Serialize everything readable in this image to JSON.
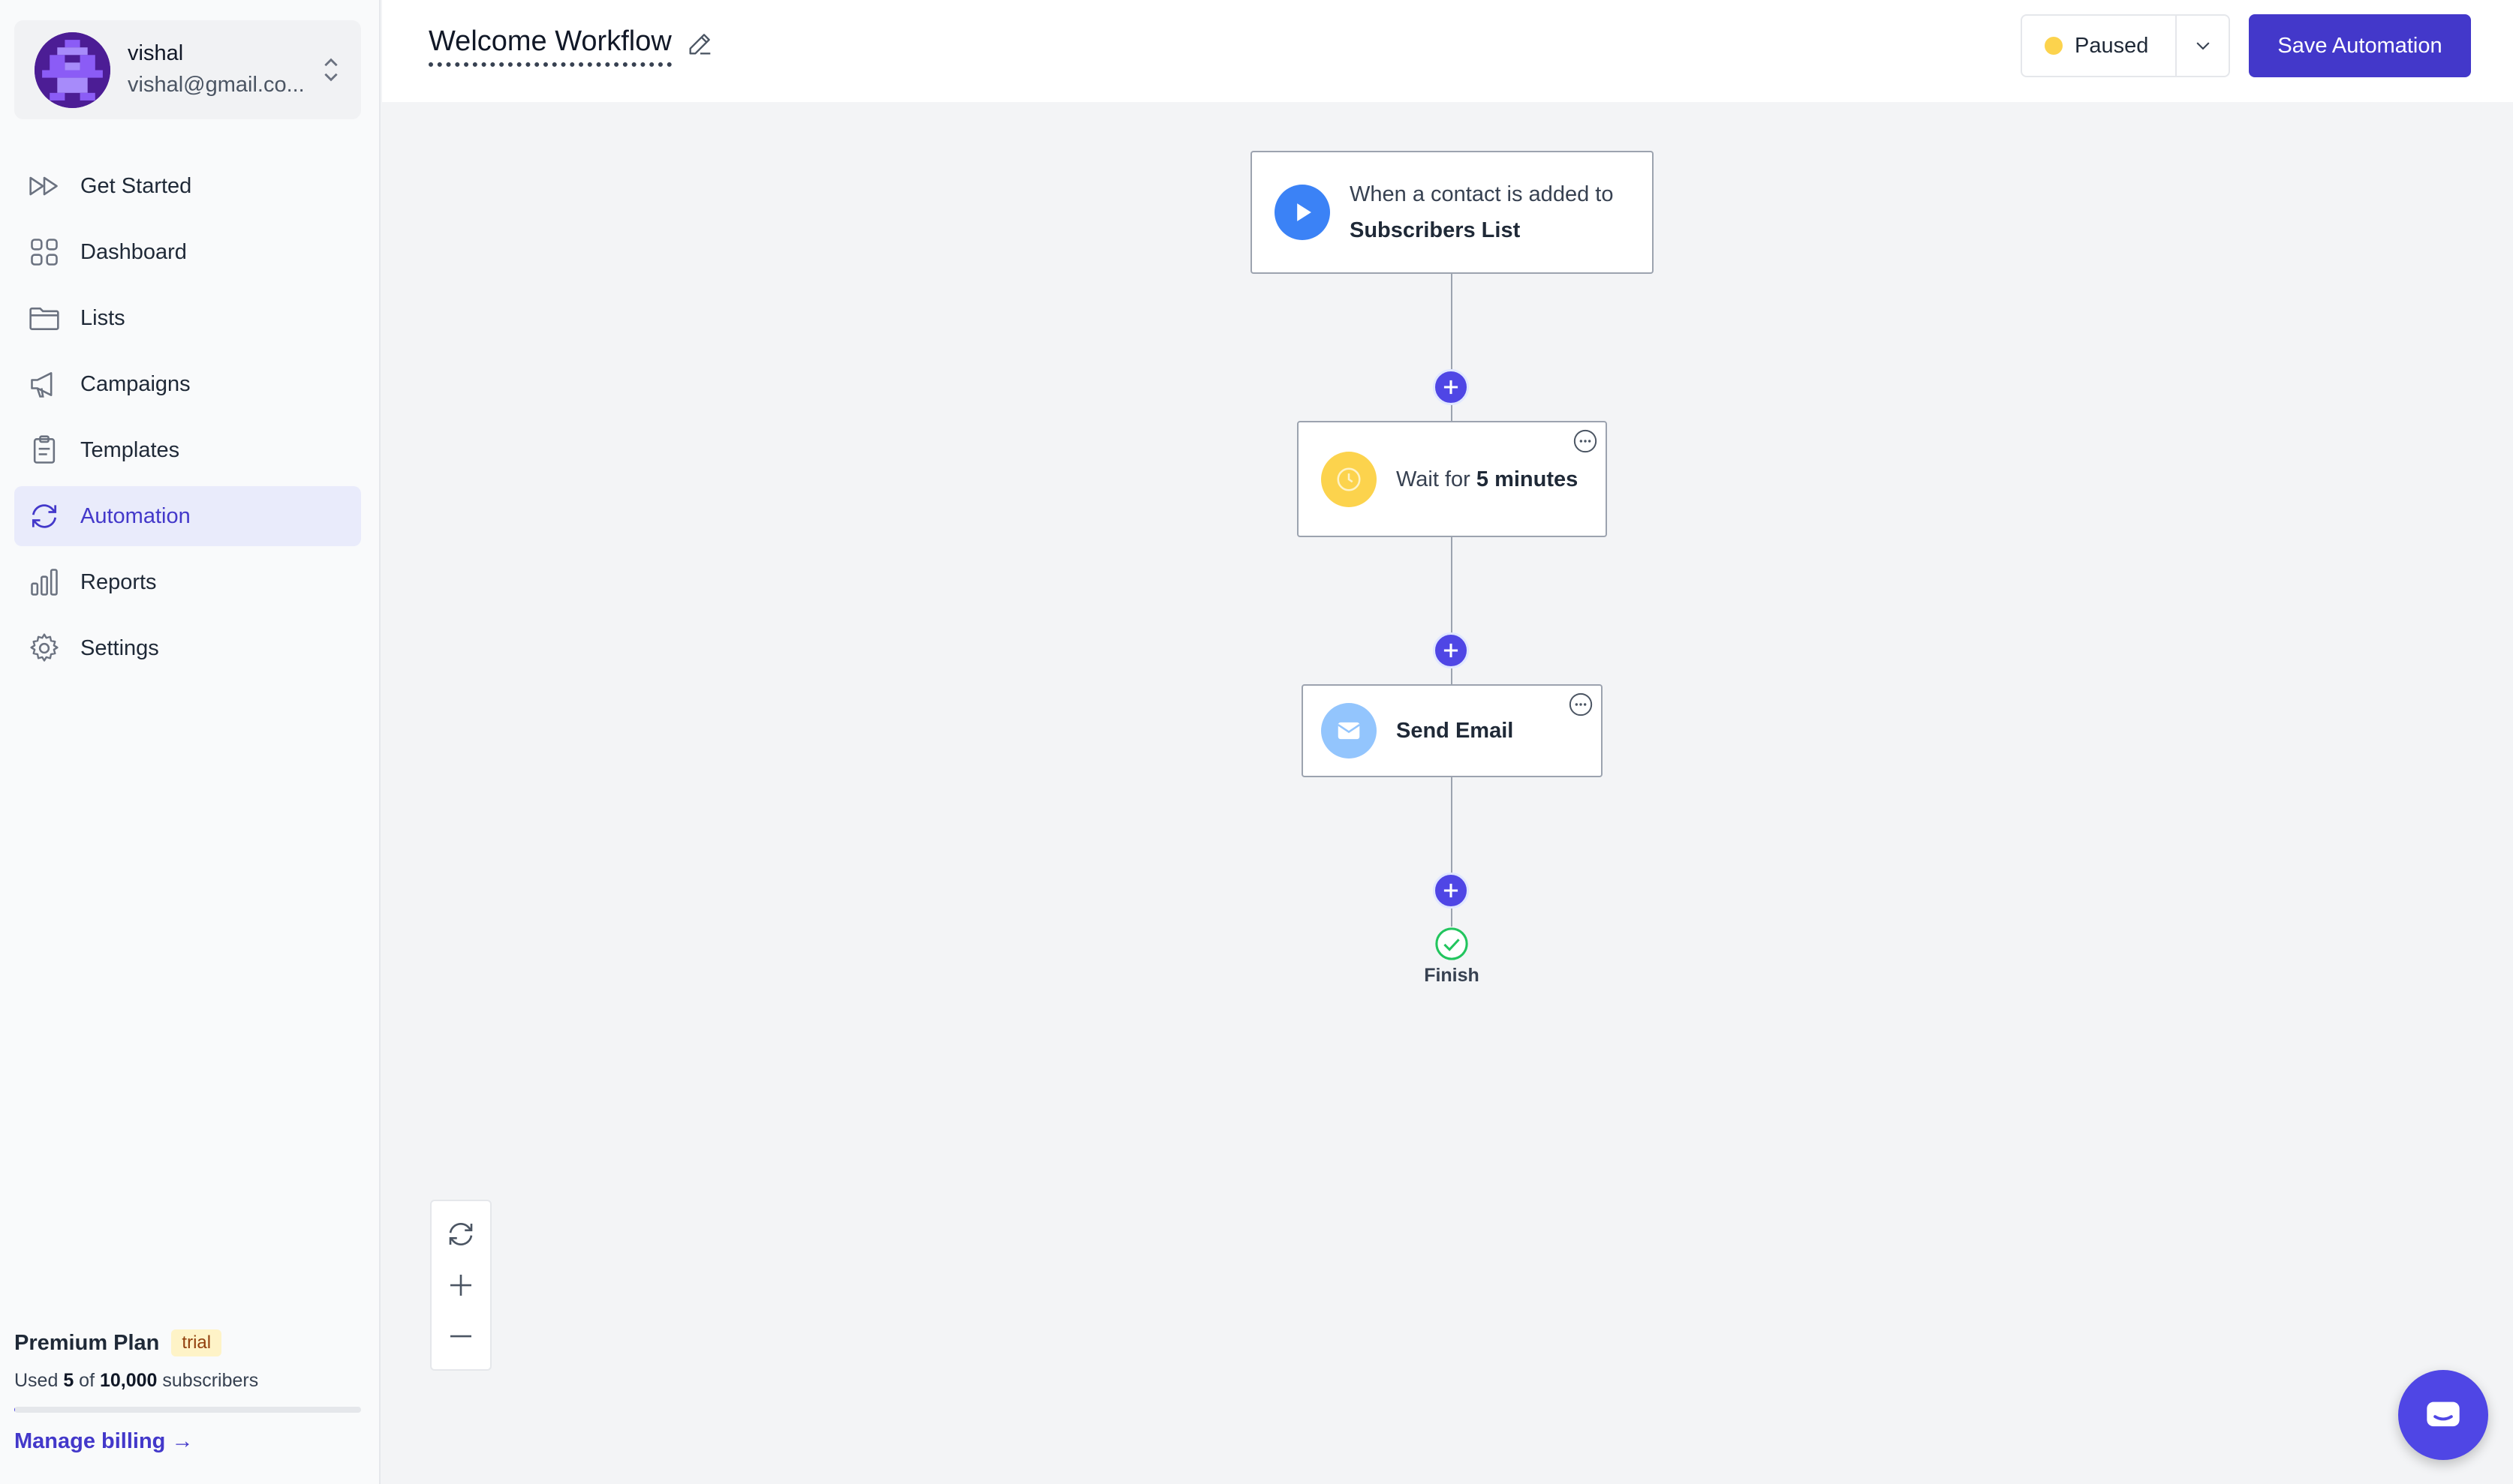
{
  "user": {
    "name": "vishal",
    "email": "vishal@gmail.co..."
  },
  "nav": {
    "items": [
      {
        "label": "Get Started",
        "icon": "fast-forward-icon",
        "active": false
      },
      {
        "label": "Dashboard",
        "icon": "grid-icon",
        "active": false
      },
      {
        "label": "Lists",
        "icon": "folder-icon",
        "active": false
      },
      {
        "label": "Campaigns",
        "icon": "megaphone-icon",
        "active": false
      },
      {
        "label": "Templates",
        "icon": "clipboard-icon",
        "active": true
      },
      {
        "label": "Automation",
        "icon": "refresh-icon",
        "active": true
      },
      {
        "label": "Reports",
        "icon": "bar-chart-icon",
        "active": false
      },
      {
        "label": "Settings",
        "icon": "gear-icon",
        "active": false
      }
    ]
  },
  "plan": {
    "title": "Premium Plan",
    "badge": "trial",
    "usage_prefix": "Used ",
    "used": "5",
    "usage_mid": " of ",
    "limit": "10,000",
    "usage_suffix": " subscribers",
    "used_fraction": 0.0005,
    "billing_link": "Manage billing →"
  },
  "header": {
    "title": "Welcome Workflow",
    "status": "Paused",
    "save_label": "Save Automation"
  },
  "workflow": {
    "trigger": {
      "prefix": "When a contact is added to",
      "list": "Subscribers List"
    },
    "wait": {
      "prefix": "Wait for ",
      "duration": "5 minutes"
    },
    "email": {
      "label": "Send Email"
    },
    "finish": {
      "label": "Finish"
    }
  },
  "colors": {
    "accent": "#4338ca",
    "status_paused": "#fcd34d",
    "trigger_icon": "#3b82f6",
    "finish_green": "#22c55e"
  }
}
